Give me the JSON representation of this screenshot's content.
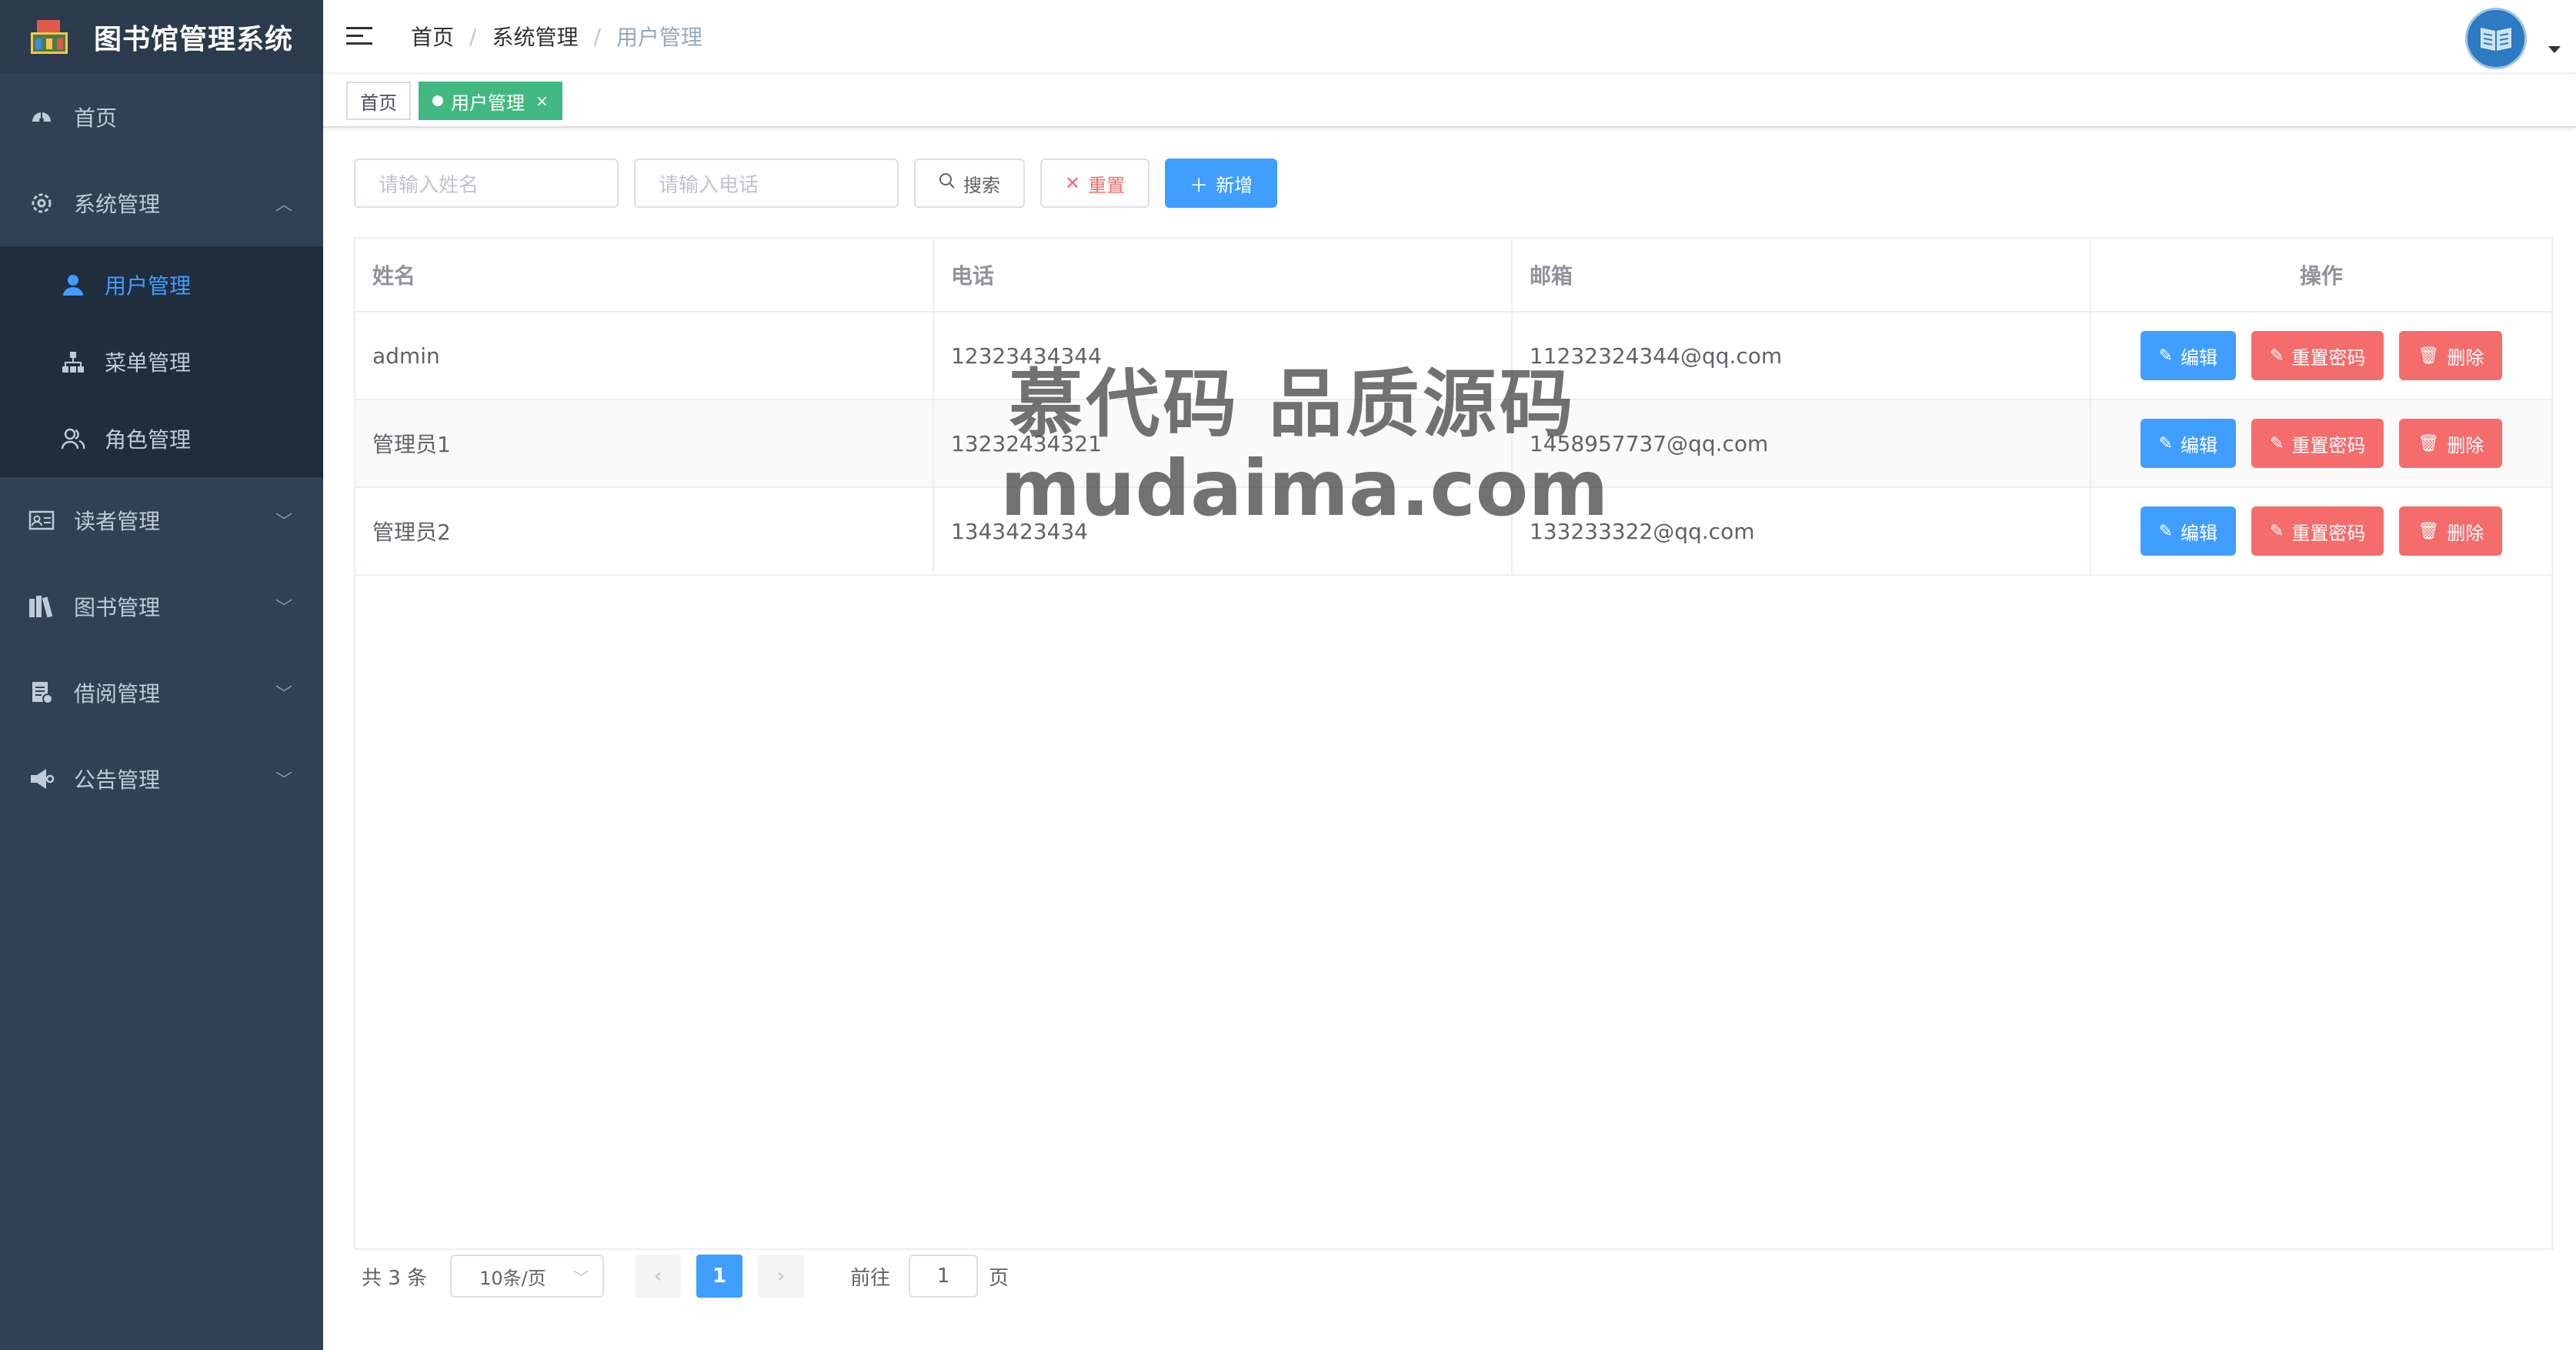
{
  "app": {
    "title": "图书馆管理系统"
  },
  "sidebar": {
    "items": [
      {
        "label": "首页"
      },
      {
        "label": "系统管理"
      },
      {
        "label": "读者管理"
      },
      {
        "label": "图书管理"
      },
      {
        "label": "借阅管理"
      },
      {
        "label": "公告管理"
      }
    ],
    "sub": [
      {
        "label": "用户管理"
      },
      {
        "label": "菜单管理"
      },
      {
        "label": "角色管理"
      }
    ]
  },
  "breadcrumb": [
    "首页",
    "系统管理",
    "用户管理"
  ],
  "tags": [
    {
      "label": "首页"
    },
    {
      "label": "用户管理"
    }
  ],
  "search": {
    "name_placeholder": "请输入姓名",
    "phone_placeholder": "请输入电话",
    "search_label": "搜索",
    "reset_label": "重置",
    "add_label": "新增"
  },
  "table": {
    "headers": [
      "姓名",
      "电话",
      "邮箱",
      "操作"
    ],
    "rows": [
      {
        "name": "admin",
        "phone": "12323434344",
        "email": "11232324344@qq.com"
      },
      {
        "name": "管理员1",
        "phone": "13232434321",
        "email": "1458957737@qq.com"
      },
      {
        "name": "管理员2",
        "phone": "1343423434",
        "email": "133233322@qq.com"
      }
    ],
    "actions": {
      "edit": "编辑",
      "reset_pwd": "重置密码",
      "delete": "删除"
    }
  },
  "pagination": {
    "total": "共 3 条",
    "page_size": "10条/页",
    "current": "1",
    "goto_label": "前往",
    "goto_value": "1",
    "page_unit": "页"
  },
  "watermark": {
    "line1": "慕代码 品质源码",
    "line2": "mudaima.com"
  },
  "colors": {
    "sidebar": "#304156",
    "primary": "#409eff",
    "danger": "#f56c6c",
    "tag_active": "#42b983"
  }
}
